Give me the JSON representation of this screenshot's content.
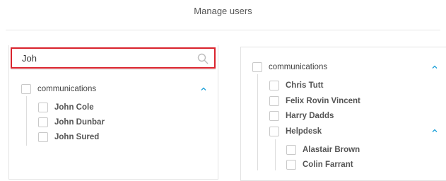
{
  "header": {
    "title": "Manage users"
  },
  "left_panel": {
    "search": {
      "value": "Joh"
    },
    "groups": [
      {
        "label": "communications",
        "expanded": true,
        "users": [
          "John Cole",
          "John Dunbar",
          "John Sured"
        ]
      }
    ]
  },
  "right_panel": {
    "groups": [
      {
        "label": "communications",
        "expanded": true,
        "items": [
          {
            "label": "Chris Tutt",
            "type": "user"
          },
          {
            "label": "Felix Rovin Vincent",
            "type": "user"
          },
          {
            "label": "Harry Dadds",
            "type": "user"
          },
          {
            "label": "Helpdesk",
            "type": "group",
            "expanded": true,
            "users": [
              "Alastair Brown",
              "Colin Farrant"
            ]
          }
        ]
      }
    ]
  },
  "colors": {
    "accent": "#1a9fd8",
    "search_border": "#d9232d",
    "checkbox_border": "#c9c9c9"
  },
  "icons": {
    "search": "search-icon",
    "collapse": "chevron-up-icon"
  }
}
